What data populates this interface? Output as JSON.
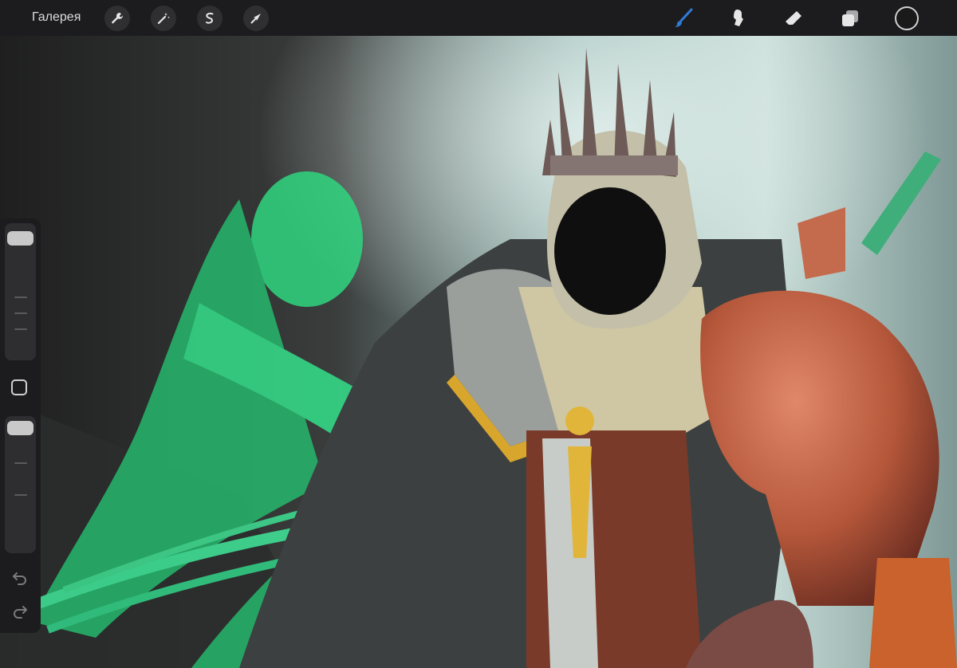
{
  "toolbar": {
    "gallery_label": "Галерея",
    "action_icons": [
      "wrench-icon",
      "magic-wand-icon",
      "selection-icon",
      "transform-arrow-icon"
    ],
    "tool_icons": [
      "brush-icon",
      "smudge-icon",
      "eraser-icon",
      "layers-icon",
      "color-icon"
    ],
    "active_tool": "brush",
    "active_color": "#2f7bd6"
  },
  "sidebar": {
    "brush_size": 0.92,
    "opacity": 0.95
  },
  "colors": {
    "ghost_green": "#2fd67f",
    "copper": "#b5573a",
    "cloth": "#cfc7a3",
    "gold": "#e0b53a"
  }
}
